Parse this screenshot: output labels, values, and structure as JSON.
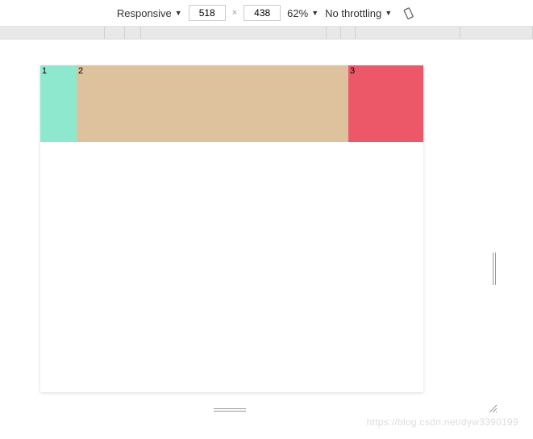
{
  "toolbar": {
    "device_label": "Responsive",
    "width": "518",
    "height": "438",
    "zoom_label": "62%",
    "throttling_label": "No throttling"
  },
  "content": {
    "boxes": [
      "1",
      "2",
      "3"
    ],
    "colors": {
      "col1": "#8ee8ce",
      "col2": "#dec19d",
      "col3": "#ed5869"
    }
  },
  "watermark": "https://blog.csdn.net/dyw3390199"
}
